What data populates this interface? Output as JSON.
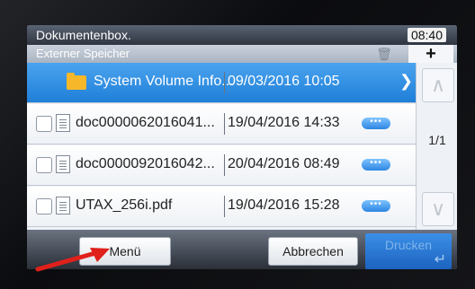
{
  "header": {
    "title": "Dokumentenbox.",
    "time": "08:40"
  },
  "subheader": {
    "title": "Externer Speicher",
    "trash_icon": "trash-icon",
    "add_label": "+"
  },
  "files": [
    {
      "name": "System Volume Info...",
      "date": "09/03/2016 10:05",
      "type": "folder",
      "selected": true
    },
    {
      "name": "doc0000062016041...",
      "date": "19/04/2016 14:33",
      "type": "document",
      "selected": false
    },
    {
      "name": "doc0000092016042...",
      "date": "20/04/2016 08:49",
      "type": "document",
      "selected": false
    },
    {
      "name": "UTAX_256i.pdf",
      "date": "19/04/2016 15:28",
      "type": "document",
      "selected": false
    }
  ],
  "more_label": "•••",
  "pagination": {
    "indicator": "1/1"
  },
  "footer": {
    "menu_label": "Menü",
    "cancel_label": "Abbrechen",
    "print_label": "Drucken"
  },
  "colors": {
    "selection": "#1f7fd8",
    "folder": "#f6b72a",
    "annotation_arrow": "#e0201a"
  }
}
